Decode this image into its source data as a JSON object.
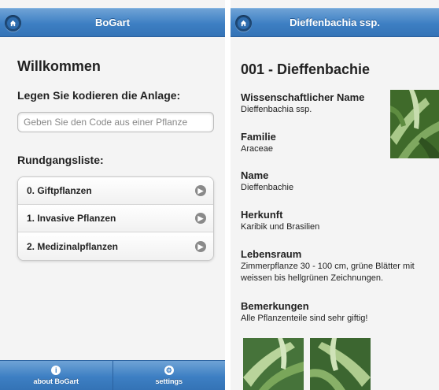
{
  "left": {
    "header_title": "BoGart",
    "welcome": "Willkommen",
    "scan_prompt": "Legen Sie kodieren die Anlage:",
    "code_input": {
      "placeholder": "Geben Sie den Code aus einer Pflanze",
      "value": ""
    },
    "tours_heading": "Rundgangsliste:",
    "tours": [
      {
        "label": "0. Giftpflanzen",
        "icon": "arrow-right-icon"
      },
      {
        "label": "1. Invasive Pflanzen",
        "icon": "arrow-right-icon"
      },
      {
        "label": "2. Medizinalpflanzen",
        "icon": "arrow-right-icon"
      }
    ],
    "footer": [
      {
        "label": "about BoGart",
        "icon": "info-icon"
      },
      {
        "label": "settings",
        "icon": "gear-icon"
      }
    ]
  },
  "right": {
    "header_title": "Dieffenbachia ssp.",
    "title": "001 - Dieffenbachie",
    "fields": [
      {
        "label": "Wissenschaftlicher Name",
        "value": "Dieffenbachia ssp."
      },
      {
        "label": "Familie",
        "value": "Araceae"
      },
      {
        "label": "Name",
        "value": "Dieffenbachie"
      },
      {
        "label": "Herkunft",
        "value": "Karibik und Brasilien"
      },
      {
        "label": "Lebensraum",
        "value": "Zimmerpflanze 30 - 100 cm, grüne Blätter mit weissen bis hellgrünen Zeichnungen."
      },
      {
        "label": "Bemerkungen",
        "value": "Alle Pflanzenteile sind sehr giftig!"
      }
    ]
  },
  "colors": {
    "bar_blue": "#3d7fc3",
    "background": "#f4f4f4",
    "leaf_green": "#5f8a3c"
  }
}
